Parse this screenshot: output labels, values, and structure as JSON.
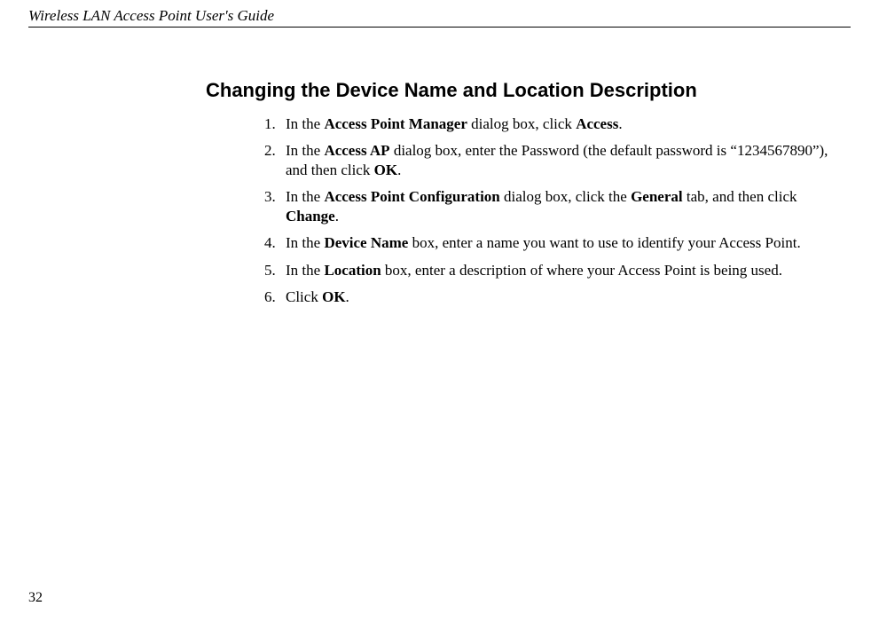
{
  "header": {
    "guide_title": "Wireless LAN Access Point User's Guide"
  },
  "section": {
    "heading": "Changing the Device Name and Location Description"
  },
  "steps": [
    {
      "num": "1.",
      "pre1": "In the ",
      "b1": "Access Point Manager",
      "mid1": " dialog box, click ",
      "b2": "Access",
      "post": "."
    },
    {
      "num": "2.",
      "pre1": "In the ",
      "b1": "Access AP",
      "mid1": " dialog box, enter the Password (the default password is “1234567890”), and then click ",
      "b2": "OK",
      "post": "."
    },
    {
      "num": "3.",
      "pre1": "In the ",
      "b1": "Access Point Configuration",
      "mid1": " dialog box, click the ",
      "b2": "General",
      "mid2": " tab, and then click ",
      "b3": "Change",
      "post": "."
    },
    {
      "num": "4.",
      "pre1": "In the ",
      "b1": "Device Name",
      "mid1": " box, enter a name you want to use to identify your Access Point.",
      "b2": "",
      "post": ""
    },
    {
      "num": "5.",
      "pre1": "In the ",
      "b1": "Location",
      "mid1": " box, enter a description of where your Access Point is being used.",
      "b2": "",
      "post": ""
    },
    {
      "num": "6.",
      "pre1": "Click ",
      "b1": "OK",
      "mid1": ".",
      "b2": "",
      "post": ""
    }
  ],
  "footer": {
    "page_number": "32"
  }
}
